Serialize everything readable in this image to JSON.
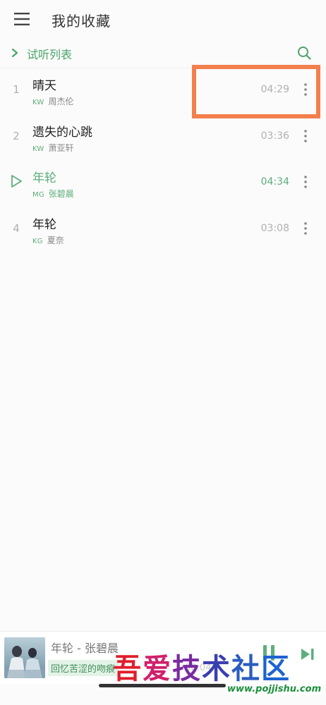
{
  "header": {
    "title": "我的收藏"
  },
  "playlist": {
    "label": "试听列表"
  },
  "songs": [
    {
      "index": "1",
      "title": "晴天",
      "source": "KW",
      "artist": "周杰伦",
      "duration": "04:29",
      "playing": false
    },
    {
      "index": "2",
      "title": "遗失的心跳",
      "source": "KW",
      "artist": "萧亚轩",
      "duration": "03:36",
      "playing": false
    },
    {
      "index": "",
      "title": "年轮",
      "source": "MG",
      "artist": "张碧晨",
      "duration": "04:34",
      "playing": true
    },
    {
      "index": "4",
      "title": "年轮",
      "source": "KG",
      "artist": "夏奈",
      "duration": "03:08",
      "playing": false
    }
  ],
  "player": {
    "title": "年轮  - 张碧晨",
    "lyric": "回忆苦涩的吻痕",
    "time": "00:04"
  },
  "watermark": {
    "text_chars": [
      "吾",
      "爱",
      "技",
      "术",
      "社",
      "区"
    ],
    "url": "www.pojjishu.com"
  },
  "colors": {
    "accent_green": "#5dae7b",
    "highlight_orange": "#f37f4c"
  },
  "icons": {
    "menu": "menu-icon",
    "search": "search-icon",
    "play": "play-icon",
    "more": "more-vertical-icon",
    "pause": "pause-icon",
    "next": "next-icon"
  }
}
